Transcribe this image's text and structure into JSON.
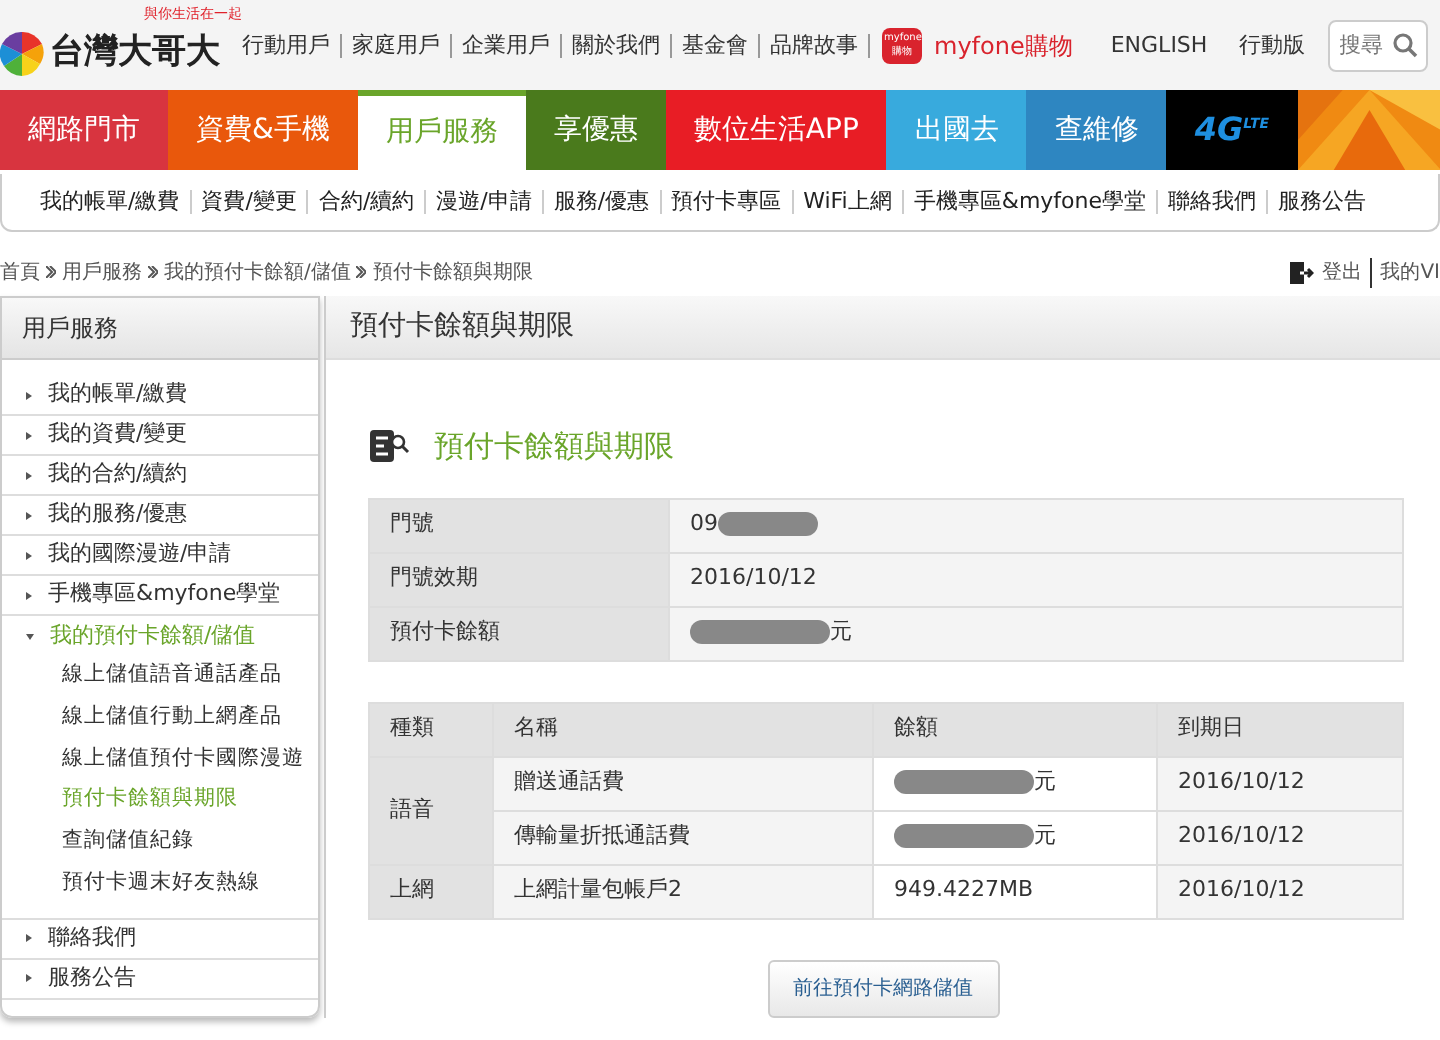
{
  "header": {
    "logo_text": "台灣大哥大",
    "tagline": "與你生活在一起",
    "links": [
      "行動用戶",
      "家庭用戶",
      "企業用戶",
      "關於我們",
      "基金會",
      "品牌故事"
    ],
    "shop": {
      "badge": [
        "myfone",
        "購物"
      ],
      "label": "myfone購物"
    },
    "lang": "ENGLISH",
    "mobile": "行動版",
    "search": {
      "placeholder": "搜尋"
    }
  },
  "main_nav": [
    {
      "label": "網路門市",
      "color": "#d8343f",
      "selected": false
    },
    {
      "label": "資費&手機",
      "color": "#e9580c",
      "selected": false
    },
    {
      "label": "用戶服務",
      "color": "#6aa52a",
      "selected": true
    },
    {
      "label": "享優惠",
      "color": "#4a7a1c",
      "selected": false
    },
    {
      "label": "數位生活APP",
      "color": "#e81d25",
      "selected": false
    },
    {
      "label": "出國去",
      "color": "#38aadd",
      "selected": false
    },
    {
      "label": "查維修",
      "color": "#2e86c1",
      "selected": false
    },
    {
      "label": "4G$^{LTE}$",
      "color": "#000000",
      "selected": false
    }
  ],
  "sub_nav": [
    "我的帳單/繳費",
    "資費/變更",
    "合約/續約",
    "漫遊/申請",
    "服務/優惠",
    "預付卡專區",
    "WiFi上網",
    "手機專區&myfone學堂",
    "聯絡我們",
    "服務公告"
  ],
  "breadcrumb": [
    "首頁",
    "用戶服務",
    "我的預付卡餘額/儲值",
    "預付卡餘額與期限"
  ],
  "user_links": [
    "登出",
    "我的VI"
  ],
  "sidebar": {
    "title": "用戶服務",
    "items": [
      {
        "label": "我的帳單/繳費",
        "expanded": false
      },
      {
        "label": "我的資費/變更",
        "expanded": false
      },
      {
        "label": "我的合約/續約",
        "expanded": false
      },
      {
        "label": "我的服務/優惠",
        "expanded": false
      },
      {
        "label": "我的國際漫遊/申請",
        "expanded": false
      },
      {
        "label": "手機專區&myfone學堂",
        "expanded": false
      },
      {
        "label": "我的預付卡餘額/儲值",
        "expanded": true,
        "children": [
          {
            "label": "線上儲值語音通話產品",
            "selected": false
          },
          {
            "label": "線上儲值行動上網產品",
            "selected": false
          },
          {
            "label": "線上儲值預付卡國際漫遊",
            "selected": false
          },
          {
            "label": "預付卡餘額與期限",
            "selected": true
          },
          {
            "label": "查詢儲值紀錄",
            "selected": false
          },
          {
            "label": "預付卡週末好友熱線",
            "selected": false
          }
        ]
      },
      {
        "label": "聯絡我們",
        "expanded": false
      },
      {
        "label": "服務公告",
        "expanded": false
      }
    ]
  },
  "panel": {
    "title": "預付卡餘額與期限",
    "heading": "預付卡餘額與期限",
    "info_rows": [
      {
        "label": "門號",
        "value": "09",
        "redacted": true,
        "redact_first": false
      },
      {
        "label": "門號效期",
        "value": "2016/10/12",
        "redacted": false
      },
      {
        "label": "預付卡餘額",
        "value": "元",
        "redacted": true,
        "redact_first": true
      }
    ],
    "balance_table": {
      "columns": [
        "種類",
        "名稱",
        "餘額",
        "到期日"
      ],
      "groups": [
        {
          "type": "語音",
          "rows": [
            {
              "name": "贈送通話費",
              "balance": "元",
              "redacted": true,
              "expiry": "2016/10/12"
            },
            {
              "name": "傳輸量折抵通話費",
              "balance": "元",
              "redacted": true,
              "expiry": "2016/10/12"
            }
          ]
        },
        {
          "type": "上網",
          "rows": [
            {
              "name": "上網計量包帳戶2",
              "balance": "949.4227MB",
              "redacted": false,
              "expiry": "2016/10/12"
            }
          ]
        }
      ]
    },
    "button": "前往預付卡網路儲值"
  }
}
